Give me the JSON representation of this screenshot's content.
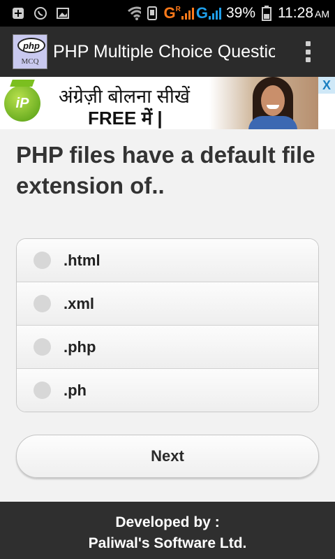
{
  "status_bar": {
    "carrier_marks": "GRG",
    "battery_percent": "39%",
    "time": "11:28",
    "ampm": "AM",
    "icons": [
      "plus-icon",
      "whatsapp-icon",
      "image-icon",
      "wifi-icon",
      "phone-icon",
      "signal-icon",
      "battery-icon"
    ]
  },
  "action_bar": {
    "app_logo_text": "php",
    "app_logo_subtext": "MCQ",
    "title": "PHP Multiple Choice Questions"
  },
  "ad": {
    "logo_text": "iP",
    "line1": "अंग्रेज़ी बोलना सीखें",
    "line2": "FREE में |",
    "close_label": "X"
  },
  "quiz": {
    "question": "PHP files have a default file extension of..",
    "options": [
      ".html",
      ".xml",
      ".php",
      ".ph"
    ],
    "next_label": "Next"
  },
  "footer": {
    "line1": "Developed by :",
    "line2": "Paliwal's Software Ltd."
  },
  "colors": {
    "action_bar": "#2b2b2b",
    "footer": "#2f2f2f",
    "status_bar": "#000000",
    "signal_accent": "#ff7a1a",
    "background": "#f2f2f2"
  }
}
